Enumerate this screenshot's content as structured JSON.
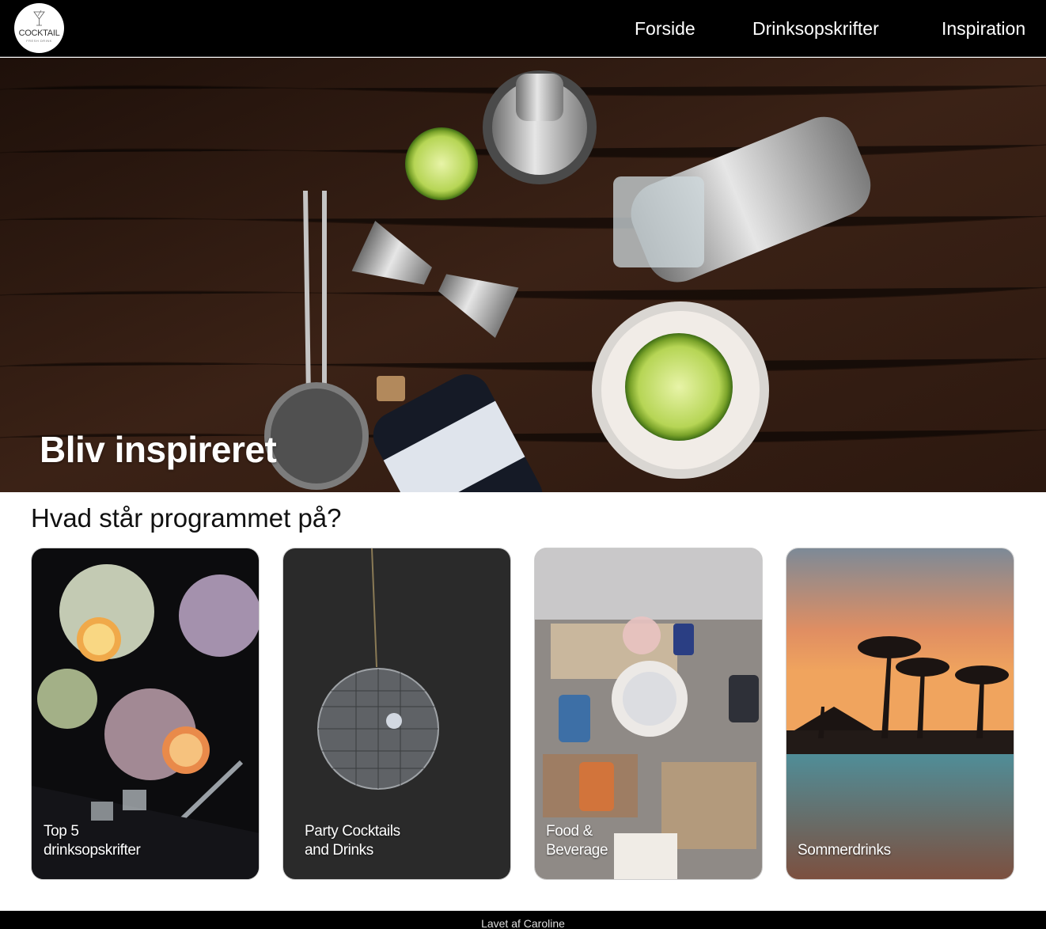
{
  "header": {
    "logo": {
      "text": "COCKTAIL",
      "subtext": "FRESH DRINK"
    },
    "nav": [
      {
        "label": "Forside"
      },
      {
        "label": "Drinksopskrifter"
      },
      {
        "label": "Inspiration"
      }
    ]
  },
  "hero": {
    "title": "Bliv inspireret"
  },
  "section": {
    "title": "Hvad står programmet på?"
  },
  "cards": [
    {
      "line1": "Top 5",
      "line2": "drinksopskrifter"
    },
    {
      "line1": "Party Cocktails",
      "line2": "and Drinks"
    },
    {
      "line1": "Food &",
      "line2": "Beverage"
    },
    {
      "line1": "Sommerdrinks",
      "line2": ""
    }
  ],
  "footer": {
    "text": "Lavet af Caroline"
  },
  "colors": {
    "header_bg": "#000000",
    "footer_bg": "#000000",
    "text_light": "#ffffff",
    "page_bg": "#ffffff"
  }
}
